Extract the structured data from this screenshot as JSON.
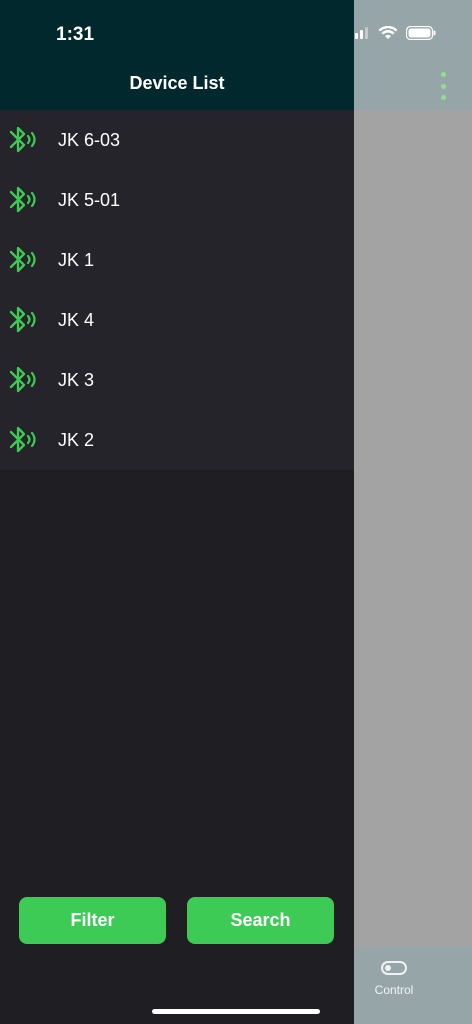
{
  "status_bar": {
    "time": "1:31"
  },
  "drawer": {
    "title": "Device List",
    "devices": [
      {
        "name": "JK 6-03",
        "icon": "bluetooth-icon"
      },
      {
        "name": "JK 5-01",
        "icon": "bluetooth-icon"
      },
      {
        "name": "JK 1",
        "icon": "bluetooth-icon"
      },
      {
        "name": "JK 4",
        "icon": "bluetooth-icon"
      },
      {
        "name": "JK 3",
        "icon": "bluetooth-icon"
      },
      {
        "name": "JK 2",
        "icon": "bluetooth-icon"
      }
    ],
    "filter_label": "Filter",
    "search_label": "Search"
  },
  "background_page": {
    "tab_control_label": "Control"
  },
  "colors": {
    "accent_green": "#3ecb55",
    "drawer_header": "#01282c",
    "drawer_bg": "#1f1e23",
    "list_bg": "#25242a"
  }
}
